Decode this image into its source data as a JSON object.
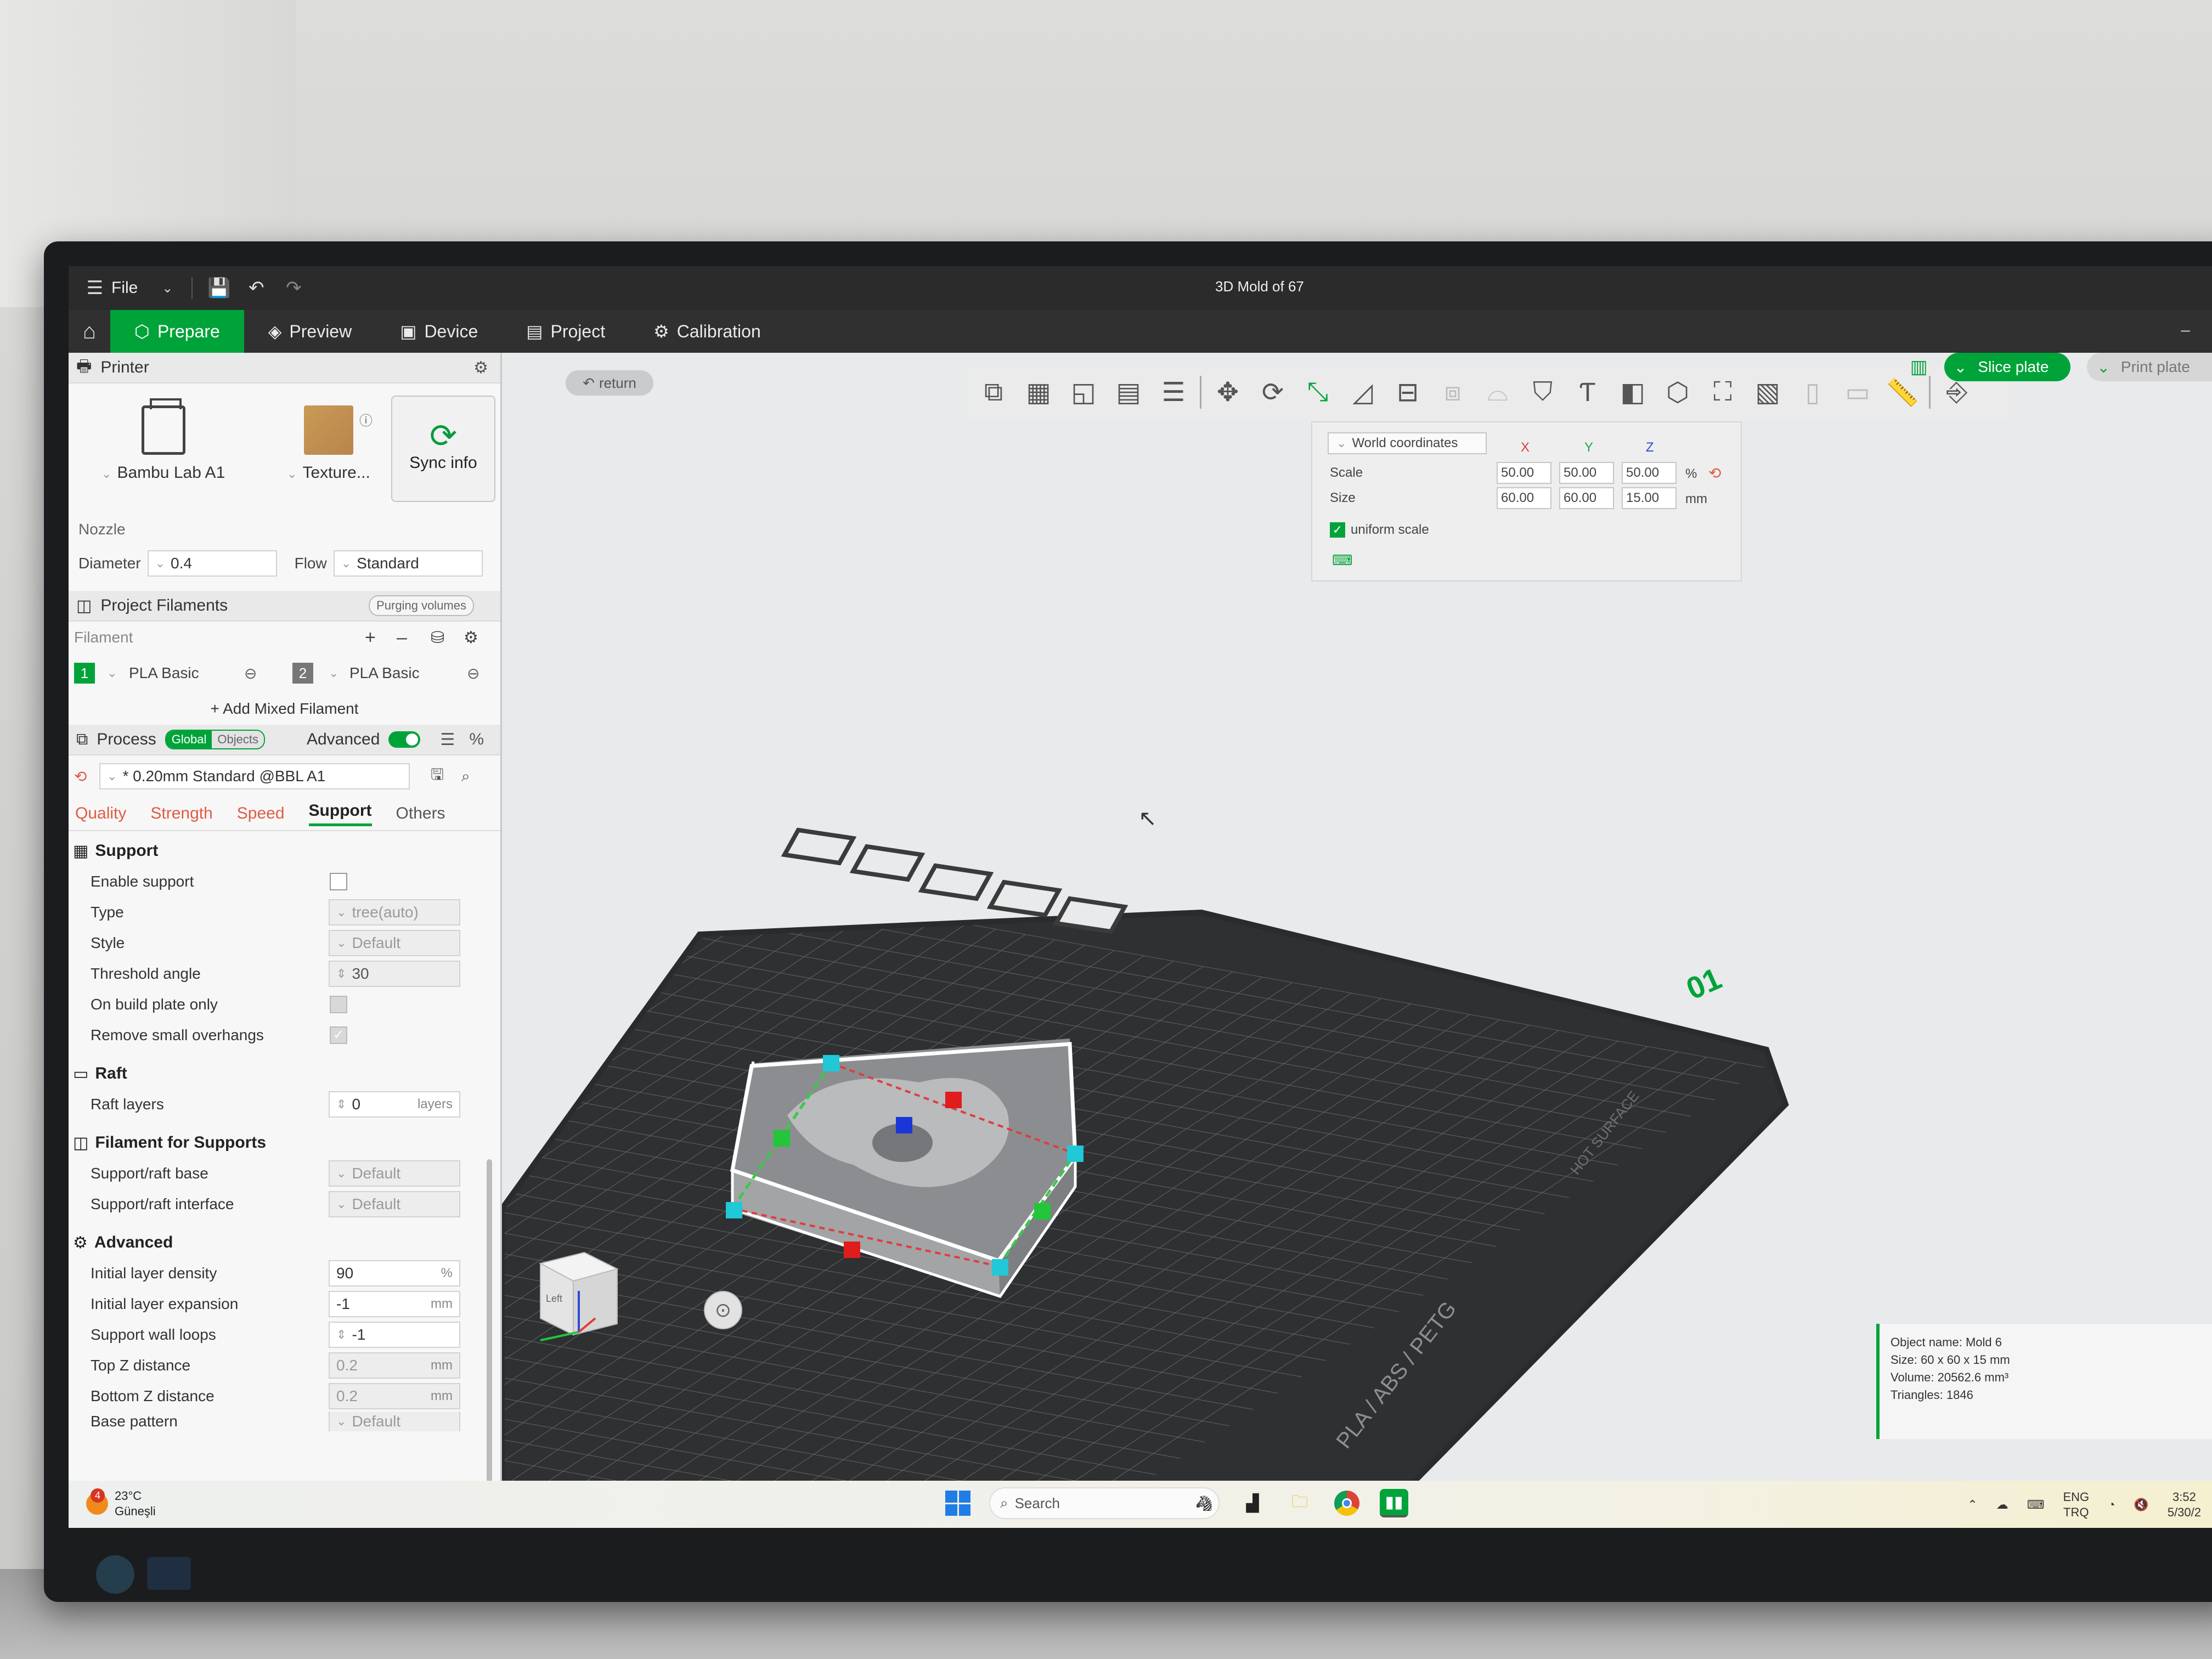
{
  "window": {
    "title": "3D Mold of 67",
    "menu_label": "File",
    "minimize": "–"
  },
  "tabs": [
    {
      "label": "Prepare",
      "icon": "cube-icon",
      "active": true
    },
    {
      "label": "Preview",
      "icon": "layers-icon"
    },
    {
      "label": "Device",
      "icon": "device-icon"
    },
    {
      "label": "Project",
      "icon": "document-icon"
    },
    {
      "label": "Calibration",
      "icon": "calibration-icon"
    }
  ],
  "printer": {
    "header": "Printer",
    "name": "Bambu Lab A1",
    "plate": "Texture...",
    "sync_label": "Sync info",
    "nozzle_label": "Nozzle",
    "diameter_label": "Diameter",
    "diameter_value": "0.4",
    "flow_label": "Flow",
    "flow_value": "Standard"
  },
  "filaments": {
    "header": "Project Filaments",
    "purge_label": "Purging volumes",
    "filament_label": "Filament",
    "items": [
      {
        "num": "1",
        "name": "PLA Basic",
        "color": "#00a33a"
      },
      {
        "num": "2",
        "name": "PLA Basic",
        "color": "#777777"
      }
    ],
    "add_mixed": "+ Add Mixed Filament"
  },
  "process": {
    "header": "Process",
    "global_label": "Global",
    "objects_label": "Objects",
    "advanced_label": "Advanced",
    "profile": "* 0.20mm Standard @BBL A1",
    "tabs": [
      {
        "label": "Quality",
        "style": "warn"
      },
      {
        "label": "Strength",
        "style": "warn"
      },
      {
        "label": "Speed",
        "style": "warn"
      },
      {
        "label": "Support",
        "style": "active"
      },
      {
        "label": "Others",
        "style": "plain"
      }
    ]
  },
  "support": {
    "title": "Support",
    "enable_label": "Enable support",
    "type_label": "Type",
    "type_value": "tree(auto)",
    "style_label": "Style",
    "style_value": "Default",
    "threshold_label": "Threshold angle",
    "threshold_value": "30",
    "build_plate_label": "On build plate only",
    "remove_small_label": "Remove small overhangs"
  },
  "raft": {
    "title": "Raft",
    "layers_label": "Raft layers",
    "layers_value": "0",
    "layers_unit": "layers"
  },
  "filament_supports": {
    "title": "Filament for Supports",
    "base_label": "Support/raft base",
    "base_value": "Default",
    "interface_label": "Support/raft interface",
    "interface_value": "Default"
  },
  "advanced": {
    "title": "Advanced",
    "density_label": "Initial layer density",
    "density_value": "90",
    "density_unit": "%",
    "expansion_label": "Initial layer expansion",
    "expansion_value": "-1",
    "expansion_unit": "mm",
    "wall_loops_label": "Support wall loops",
    "wall_loops_value": "-1",
    "top_z_label": "Top Z distance",
    "top_z_value": "0.2",
    "top_z_unit": "mm",
    "bottom_z_label": "Bottom Z distance",
    "bottom_z_value": "0.2",
    "bottom_z_unit": "mm",
    "base_pattern_label": "Base pattern",
    "base_pattern_value": "Default"
  },
  "viewport": {
    "return_label": "return",
    "slice_label": "Slice plate",
    "print_label": "Print plate",
    "plate_number": "01",
    "plate_text": "PLA / ABS / PETG",
    "plate_text2": "HOT SURFACE",
    "nav_cube_face": "Left"
  },
  "coords": {
    "mode": "World coordinates",
    "x_label": "X",
    "y_label": "Y",
    "z_label": "Z",
    "scale_label": "Scale",
    "size_label": "Size",
    "scale_x": "50.00",
    "scale_y": "50.00",
    "scale_z": "50.00",
    "scale_unit": "%",
    "size_x": "60.00",
    "size_y": "60.00",
    "size_z": "15.00",
    "size_unit": "mm",
    "uniform_label": "uniform scale"
  },
  "object_info": {
    "name": "Object name: Mold 6",
    "size": "Size: 60 x 60 x 15 mm",
    "volume": "Volume: 20562.6 mm³",
    "triangles": "Triangles: 1846"
  },
  "taskbar": {
    "temp": "23°C",
    "weather": "Güneşli",
    "badge": "4",
    "search_placeholder": "Search",
    "lang1": "ENG",
    "lang2": "TRQ",
    "time": "3:52",
    "date": "5/30/2"
  }
}
